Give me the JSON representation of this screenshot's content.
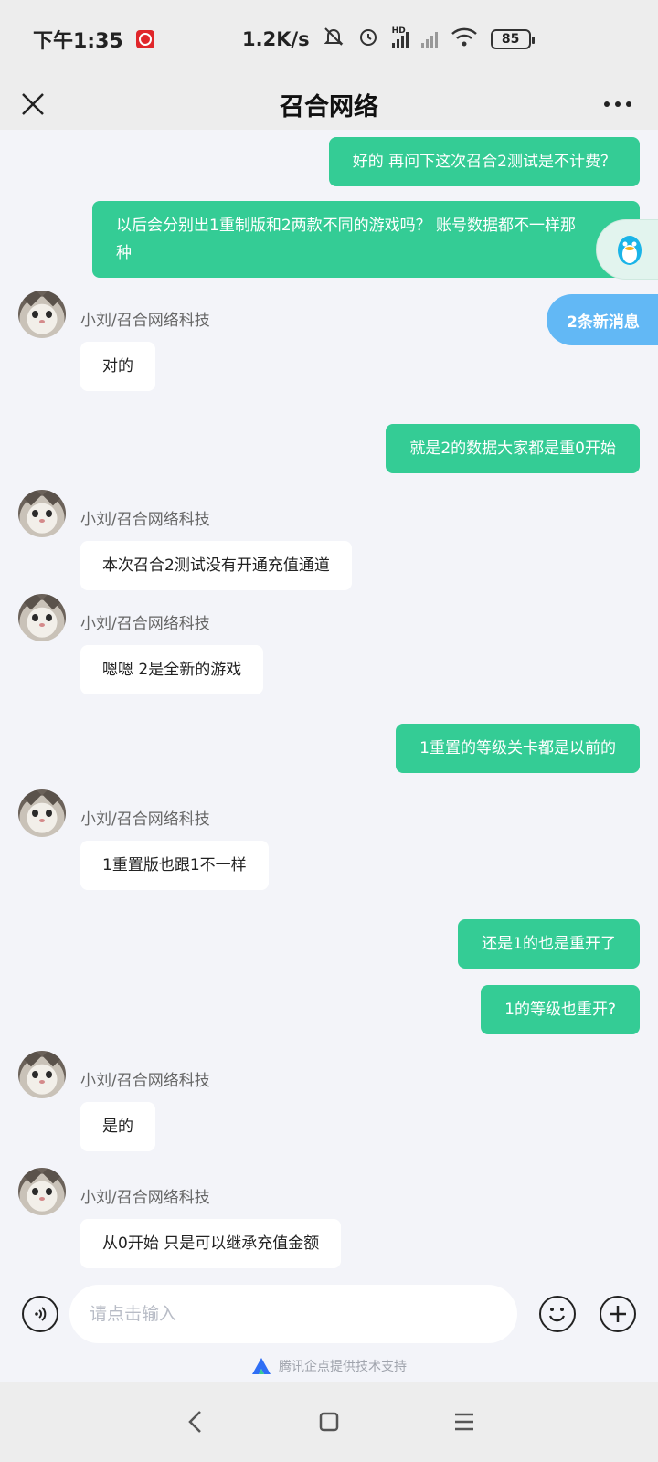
{
  "status_bar": {
    "time": "下午1:35",
    "net_speed": "1.2K/s",
    "battery": "85",
    "network_label": "HD"
  },
  "header": {
    "title": "召合网络"
  },
  "chat": {
    "messages": [
      {
        "direction": "out",
        "text": "好的 再问下这次召合2测试是不计费？"
      },
      {
        "direction": "out",
        "text_line1": "以后会分别出1重制版和2两款不同的游戏吗？ 账号数据都不一样那",
        "text_line2": "种"
      },
      {
        "direction": "in",
        "sender": "小刘/召合网络科技",
        "text": "对的"
      },
      {
        "direction": "out",
        "text": "就是2的数据大家都是重0开始"
      },
      {
        "direction": "in",
        "sender": "小刘/召合网络科技",
        "text": "本次召合2测试没有开通充值通道"
      },
      {
        "direction": "in",
        "sender": "小刘/召合网络科技",
        "text": "嗯嗯  2是全新的游戏"
      },
      {
        "direction": "out",
        "text": "1重置的等级关卡都是以前的"
      },
      {
        "direction": "in",
        "sender": "小刘/召合网络科技",
        "text": "1重置版也跟1不一样"
      },
      {
        "direction": "out",
        "text": "还是1的也是重开了"
      },
      {
        "direction": "out",
        "text": "1的等级也重开?"
      },
      {
        "direction": "in",
        "sender": "小刘/召合网络科技",
        "text": "是的"
      },
      {
        "direction": "in",
        "sender": "小刘/召合网络科技",
        "text": "从0开始  只是可以继承充值金额"
      }
    ],
    "new_messages_badge": "2条新消息"
  },
  "input": {
    "placeholder": "请点击输入"
  },
  "footer": {
    "powered_by": "腾讯企点提供技术支持"
  },
  "colors": {
    "outgoing_bubble": "#34cc95",
    "incoming_bubble": "#ffffff",
    "badge": "#62b8f5",
    "background": "#f3f4f9"
  },
  "icons": {
    "close": "close-icon",
    "more": "more-icon",
    "qq": "qq-penguin-icon",
    "voice": "voice-icon",
    "emoji": "emoji-icon",
    "plus": "plus-icon",
    "back": "back-icon",
    "home": "home-icon",
    "menu": "menu-icon"
  }
}
